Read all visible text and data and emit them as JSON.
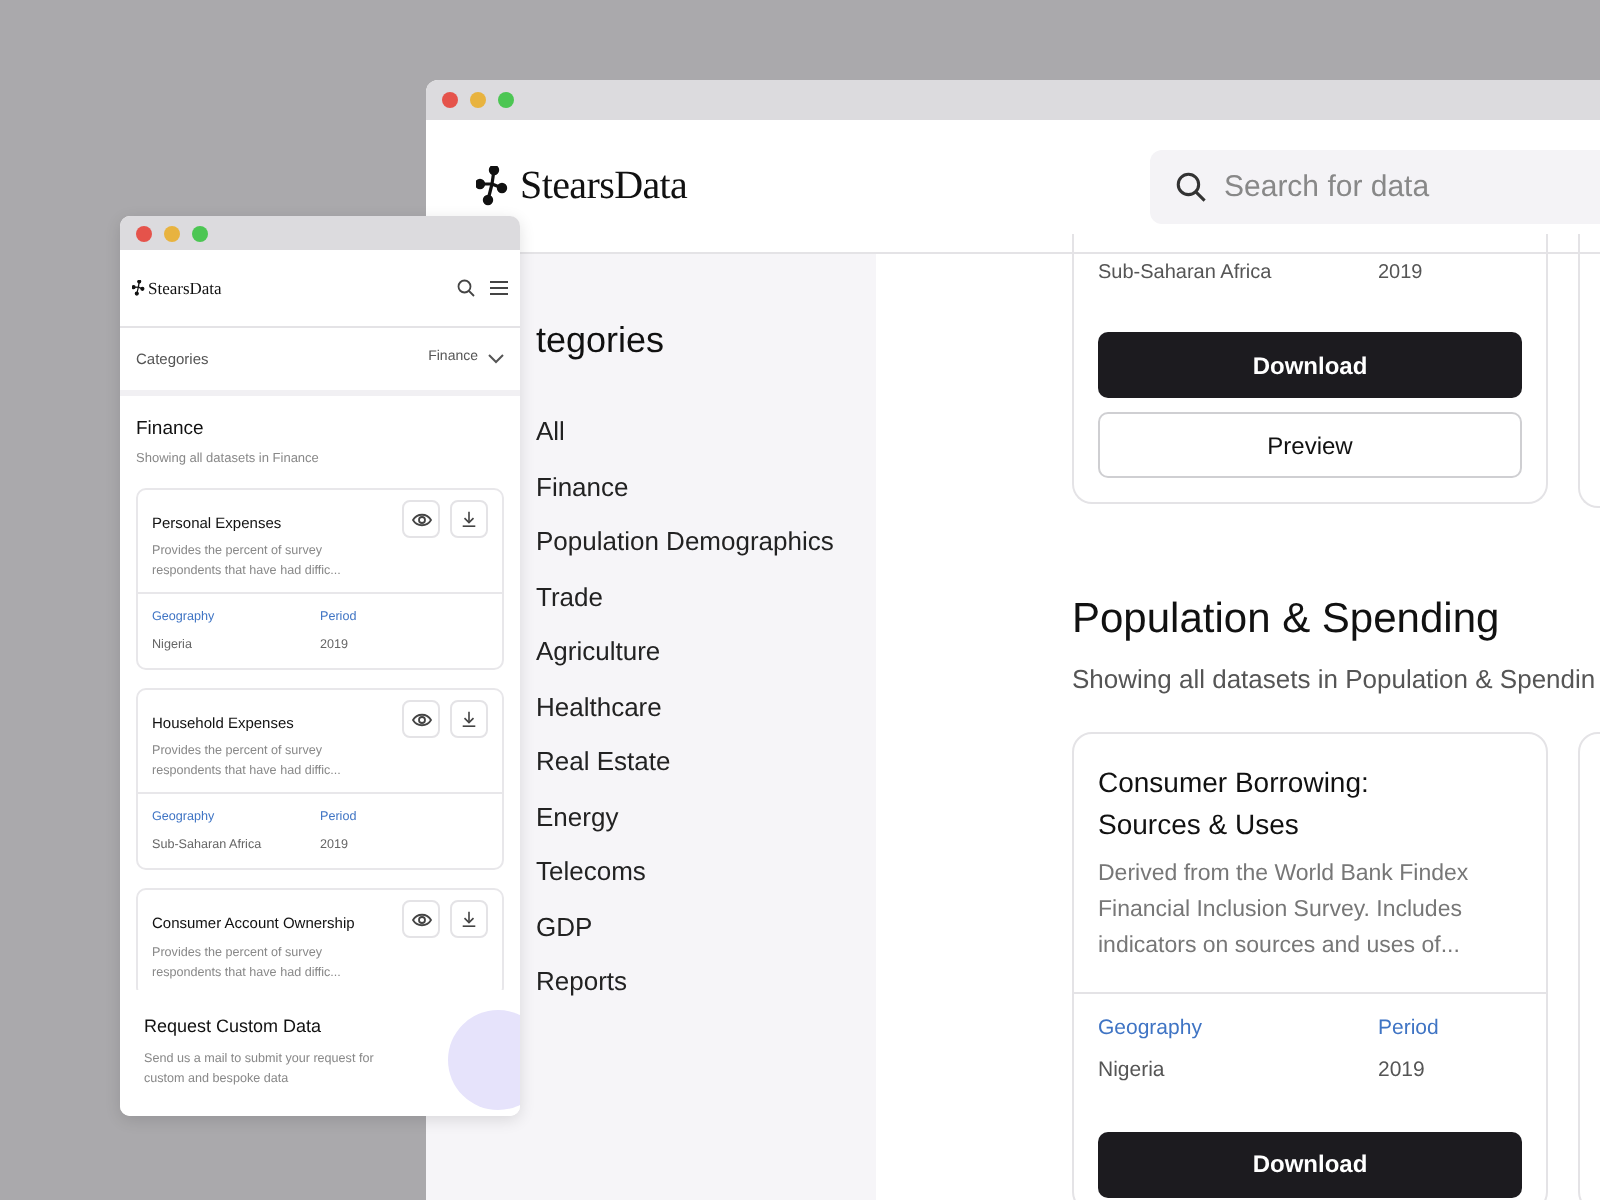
{
  "desktop": {
    "logo": "StearsData",
    "search": {
      "placeholder": "Search for data"
    },
    "sidebar": {
      "title": "tegories",
      "items": [
        {
          "label": "All"
        },
        {
          "label": "Finance"
        },
        {
          "label": "Population Demographics"
        },
        {
          "label": "Trade"
        },
        {
          "label": "Agriculture"
        },
        {
          "label": "Healthcare"
        },
        {
          "label": "Real Estate"
        },
        {
          "label": "Energy"
        },
        {
          "label": "Telecoms"
        },
        {
          "label": "GDP"
        },
        {
          "label": "Reports"
        }
      ]
    },
    "top_card": {
      "geography": "Sub-Saharan Africa",
      "period": "2019",
      "buttons": [
        {
          "kind": "primary",
          "label": "Download"
        },
        {
          "kind": "secondary",
          "label": "Preview"
        }
      ]
    },
    "section": {
      "title": "Population & Spending",
      "subtitle": "Showing all datasets in Population & Spendin"
    },
    "card": {
      "title": "Consumer Borrowing: Sources & Uses",
      "description": "Derived from the World Bank Findex Financial Inclusion Survey. Includes indicators on sources and uses of...",
      "geography_label": "Geography",
      "period_label": "Period",
      "geography": "Nigeria",
      "period": "2019",
      "button": "Download"
    }
  },
  "mobile": {
    "logo": "StearsData",
    "filter": {
      "label": "Categories",
      "value": "Finance"
    },
    "section": {
      "title": "Finance",
      "subtitle": "Showing all datasets in Finance"
    },
    "cards": [
      {
        "title": "Personal Expenses",
        "description": "Provides the percent of survey respondents that have had diffic...",
        "geography_label": "Geography",
        "period_label": "Period",
        "geography": "Nigeria",
        "period": "2019"
      },
      {
        "title": "Household Expenses",
        "description": "Provides the percent of survey respondents that have had diffic...",
        "geography_label": "Geography",
        "period_label": "Period",
        "geography": "Sub-Saharan Africa",
        "period": "2019"
      },
      {
        "title": "Consumer Account Ownership",
        "description": "Provides the percent of survey respondents that have had diffic..."
      }
    ],
    "request": {
      "title": "Request Custom Data",
      "text": "Send us a mail to submit your request for custom and bespoke data"
    }
  }
}
